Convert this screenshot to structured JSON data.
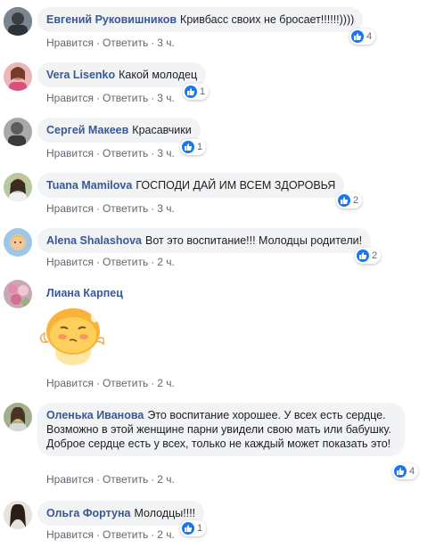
{
  "actions": {
    "like": "Нравится",
    "reply": "Ответить",
    "sep": "·"
  },
  "comments": [
    {
      "author": "Евгений Руковишников",
      "text": "Кривбасс своих не бросает!!!!!!))))",
      "time": "3 ч.",
      "reactions": "4"
    },
    {
      "author": "Vera Lisenko",
      "text": "Какой молодец",
      "time": "3 ч.",
      "reactions": "1"
    },
    {
      "author": "Сергей Макеев",
      "text": "Красавчики",
      "time": "3 ч.",
      "reactions": "1"
    },
    {
      "author": "Tuana Mamilova",
      "text": "ГОСПОДИ ДАЙ ИМ ВСЕМ ЗДОРОВЬЯ",
      "time": "3 ч.",
      "reactions": "2"
    },
    {
      "author": "Alena Shalashova",
      "text": "Вот это воспитание!!! Молодцы родители!",
      "time": "2 ч.",
      "reactions": "2"
    },
    {
      "author": "Лиана Карпец",
      "text": "",
      "time": "2 ч.",
      "reactions": ""
    },
    {
      "author": "Оленька Иванова",
      "text": "Это воспитание хорошее. У всех есть сердце. Возможно в этой женщине парни увидели свою мать или бабушку. Доброе сердце есть у всех, только не каждый может показать это!",
      "time": "2 ч.",
      "reactions": "4"
    },
    {
      "author": "Ольга Фортуна",
      "text": "Молодцы!!!!",
      "time": "2 ч.",
      "reactions": "1"
    }
  ],
  "colors": {
    "link": "#385898",
    "bubble": "#f2f3f5",
    "meta": "#606770",
    "like": "#1877f2"
  }
}
